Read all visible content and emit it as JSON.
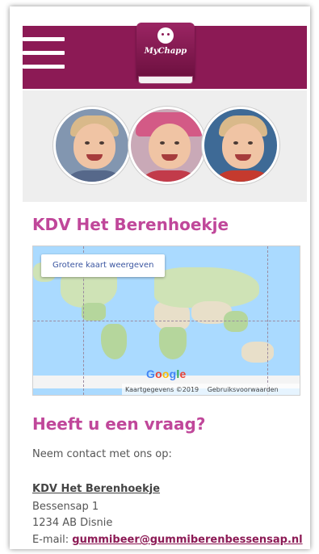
{
  "header": {
    "logo_text": "MyChapp",
    "menu_icon": "hamburger-menu-icon",
    "bg_color": "#8c1a55"
  },
  "title": "KDV Het Berenhoekje",
  "map": {
    "larger_map_label": "Grotere kaart weergeven",
    "google_letters": [
      "G",
      "o",
      "o",
      "g",
      "l",
      "e"
    ],
    "google_colors": [
      "#4285f4",
      "#ea4335",
      "#fbbc05",
      "#4285f4",
      "#34a853",
      "#ea4335"
    ],
    "attribution": "Kaartgegevens ©2019",
    "terms": "Gebruiksvoorwaarden"
  },
  "contact": {
    "title": "Heeft u een vraag?",
    "intro": "Neem contact met ons op:",
    "name": "KDV Het Berenhoekje",
    "street": "Bessensap 1",
    "city": "1234 AB Disnie",
    "email_label": "E-mail:",
    "email": "gummibeer@gummiberenbessensap.nl"
  },
  "accent_color": "#c0479a"
}
